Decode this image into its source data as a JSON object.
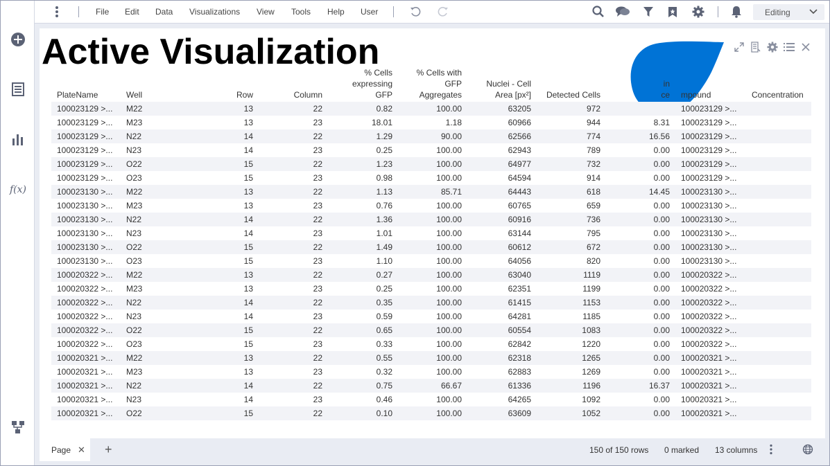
{
  "menu": {
    "items": [
      "File",
      "Edit",
      "Data",
      "Visualizations",
      "View",
      "Tools",
      "Help",
      "User"
    ],
    "mode": "Editing"
  },
  "icons": {
    "left": [
      "add-icon",
      "data-table-icon",
      "bar-chart-icon",
      "function-icon",
      "data-flow-icon"
    ],
    "top": [
      "more-icon",
      "undo-icon",
      "redo-icon",
      "search-icon",
      "comments-icon",
      "filter-icon",
      "bookmark-icon",
      "settings-icon",
      "notification-icon"
    ],
    "viz": [
      "maximize-icon",
      "details-icon",
      "settings-icon",
      "list-icon",
      "close-icon"
    ]
  },
  "colors": {
    "accent_blob": "#0073d6",
    "row_alt": "#f2f3f7",
    "frame": "#e9ecf3"
  },
  "visualization": {
    "title": "Active Visualization",
    "columns": [
      [
        "PlateName"
      ],
      [
        "Well"
      ],
      [
        "Row"
      ],
      [
        "Column"
      ],
      [
        "% Cells",
        "expressing",
        "GFP"
      ],
      [
        "% Cells with",
        "GFP",
        "Aggregates"
      ],
      [
        "Nuclei - Cell",
        "Area [px²]"
      ],
      [
        "Detected Cells"
      ],
      [
        "",
        "in",
        "ce"
      ],
      [
        "mpound"
      ],
      [
        "Concentration"
      ]
    ],
    "rows": [
      [
        "100023129 >...",
        "M22",
        "13",
        "22",
        "0.82",
        "100.00",
        "63205",
        "972",
        "",
        "100023129 >...",
        ""
      ],
      [
        "100023129 >...",
        "M23",
        "13",
        "23",
        "18.01",
        "1.18",
        "60966",
        "944",
        "8.31",
        "100023129 >...",
        ""
      ],
      [
        "100023129 >...",
        "N22",
        "14",
        "22",
        "1.29",
        "90.00",
        "62566",
        "774",
        "16.56",
        "100023129 >...",
        ""
      ],
      [
        "100023129 >...",
        "N23",
        "14",
        "23",
        "0.25",
        "100.00",
        "62943",
        "789",
        "0.00",
        "100023129 >...",
        ""
      ],
      [
        "100023129 >...",
        "O22",
        "15",
        "22",
        "1.23",
        "100.00",
        "64977",
        "732",
        "0.00",
        "100023129 >...",
        ""
      ],
      [
        "100023129 >...",
        "O23",
        "15",
        "23",
        "0.98",
        "100.00",
        "64594",
        "914",
        "0.00",
        "100023129 >...",
        ""
      ],
      [
        "100023130 >...",
        "M22",
        "13",
        "22",
        "1.13",
        "85.71",
        "64443",
        "618",
        "14.45",
        "100023130 >...",
        ""
      ],
      [
        "100023130 >...",
        "M23",
        "13",
        "23",
        "0.76",
        "100.00",
        "60765",
        "659",
        "0.00",
        "100023130 >...",
        ""
      ],
      [
        "100023130 >...",
        "N22",
        "14",
        "22",
        "1.36",
        "100.00",
        "60916",
        "736",
        "0.00",
        "100023130 >...",
        ""
      ],
      [
        "100023130 >...",
        "N23",
        "14",
        "23",
        "1.01",
        "100.00",
        "63144",
        "795",
        "0.00",
        "100023130 >...",
        ""
      ],
      [
        "100023130 >...",
        "O22",
        "15",
        "22",
        "1.49",
        "100.00",
        "60612",
        "672",
        "0.00",
        "100023130 >...",
        ""
      ],
      [
        "100023130 >...",
        "O23",
        "15",
        "23",
        "1.10",
        "100.00",
        "64056",
        "820",
        "0.00",
        "100023130 >...",
        ""
      ],
      [
        "100020322 >...",
        "M22",
        "13",
        "22",
        "0.27",
        "100.00",
        "63040",
        "1119",
        "0.00",
        "100020322 >...",
        ""
      ],
      [
        "100020322 >...",
        "M23",
        "13",
        "23",
        "0.25",
        "100.00",
        "62351",
        "1199",
        "0.00",
        "100020322 >...",
        ""
      ],
      [
        "100020322 >...",
        "N22",
        "14",
        "22",
        "0.35",
        "100.00",
        "61415",
        "1153",
        "0.00",
        "100020322 >...",
        ""
      ],
      [
        "100020322 >...",
        "N23",
        "14",
        "23",
        "0.59",
        "100.00",
        "64281",
        "1185",
        "0.00",
        "100020322 >...",
        ""
      ],
      [
        "100020322 >...",
        "O22",
        "15",
        "22",
        "0.65",
        "100.00",
        "60554",
        "1083",
        "0.00",
        "100020322 >...",
        ""
      ],
      [
        "100020322 >...",
        "O23",
        "15",
        "23",
        "0.33",
        "100.00",
        "62842",
        "1220",
        "0.00",
        "100020322 >...",
        ""
      ],
      [
        "100020321 >...",
        "M22",
        "13",
        "22",
        "0.55",
        "100.00",
        "62318",
        "1265",
        "0.00",
        "100020321 >...",
        ""
      ],
      [
        "100020321 >...",
        "M23",
        "13",
        "23",
        "0.32",
        "100.00",
        "62883",
        "1269",
        "0.00",
        "100020321 >...",
        ""
      ],
      [
        "100020321 >...",
        "N22",
        "14",
        "22",
        "0.75",
        "66.67",
        "61336",
        "1196",
        "16.37",
        "100020321 >...",
        ""
      ],
      [
        "100020321 >...",
        "N23",
        "14",
        "23",
        "0.46",
        "100.00",
        "64265",
        "1092",
        "0.00",
        "100020321 >...",
        ""
      ],
      [
        "100020321 >...",
        "O22",
        "15",
        "22",
        "0.10",
        "100.00",
        "63609",
        "1052",
        "0.00",
        "100020321 >...",
        ""
      ]
    ]
  },
  "bottom": {
    "page_tab": "Page",
    "rows_info": "150 of 150 rows",
    "marked_info": "0 marked",
    "columns_info": "13 columns"
  }
}
